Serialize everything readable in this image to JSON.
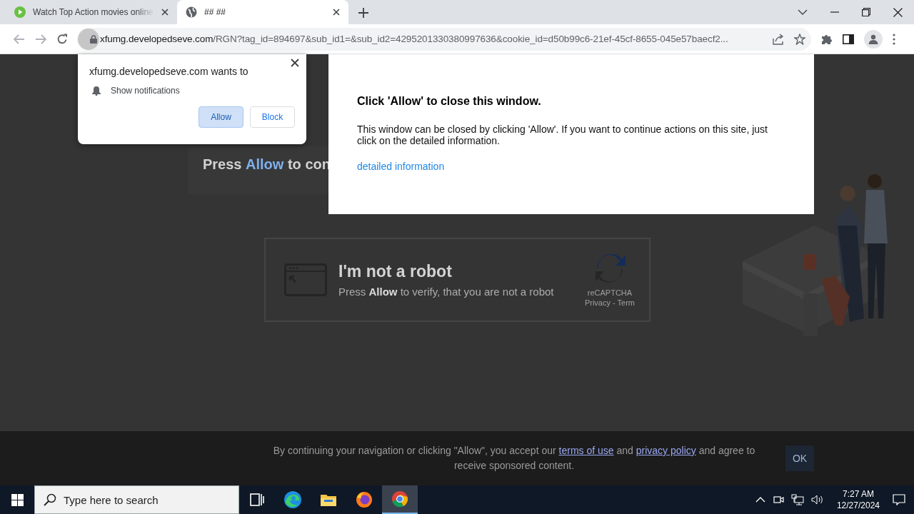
{
  "browser": {
    "tabs": [
      {
        "title": "Watch Top Action movies online",
        "selected": false,
        "kind": "play"
      },
      {
        "title": "## ##",
        "selected": true,
        "kind": "globe"
      }
    ],
    "address": {
      "host": "xfumg.developedseve.com",
      "path": "/RGN?tag_id=894697&sub_id1=&sub_id2=4295201330380997636&cookie_id=d50b99c6-21ef-45cf-8655-045e57baecf2..."
    }
  },
  "permission_prompt": {
    "title": "xfumg.developedseve.com wants to",
    "permission": "Show notifications",
    "buttons": [
      {
        "label": "Allow",
        "selected": true
      },
      {
        "label": "Block",
        "selected": false
      }
    ]
  },
  "page": {
    "headline": "Press **Allow** to con",
    "captcha": {
      "title": "I'm not a robot",
      "text": "Press **Allow** to verify, that you are not a robot",
      "brand": "reCAPTCHA",
      "links": "Privacy - Term"
    },
    "modal": {
      "title": "Click 'Allow' to close this window.",
      "text": "This window can be closed by clicking 'Allow'. If you want to continue actions on this site, just click on the detailed information.",
      "link": "detailed information"
    },
    "consent": {
      "before": "By continuing your navigation or clicking \"Allow\", you accept our",
      "terms_link": "terms of use",
      "middle": "and",
      "privacy_link": "privacy policy",
      "after": "and agree to receive sponsored content.",
      "button": "OK"
    }
  },
  "taskbar": {
    "search_placeholder": "Type here to search",
    "apps": [
      {
        "kind": "taskview",
        "selected": false
      },
      {
        "kind": "edge",
        "selected": false
      },
      {
        "kind": "explorer",
        "selected": false
      },
      {
        "kind": "firefox",
        "selected": false
      },
      {
        "kind": "chrome",
        "selected": true
      }
    ],
    "time": "7:27 AM",
    "date": "12/27/2024"
  }
}
